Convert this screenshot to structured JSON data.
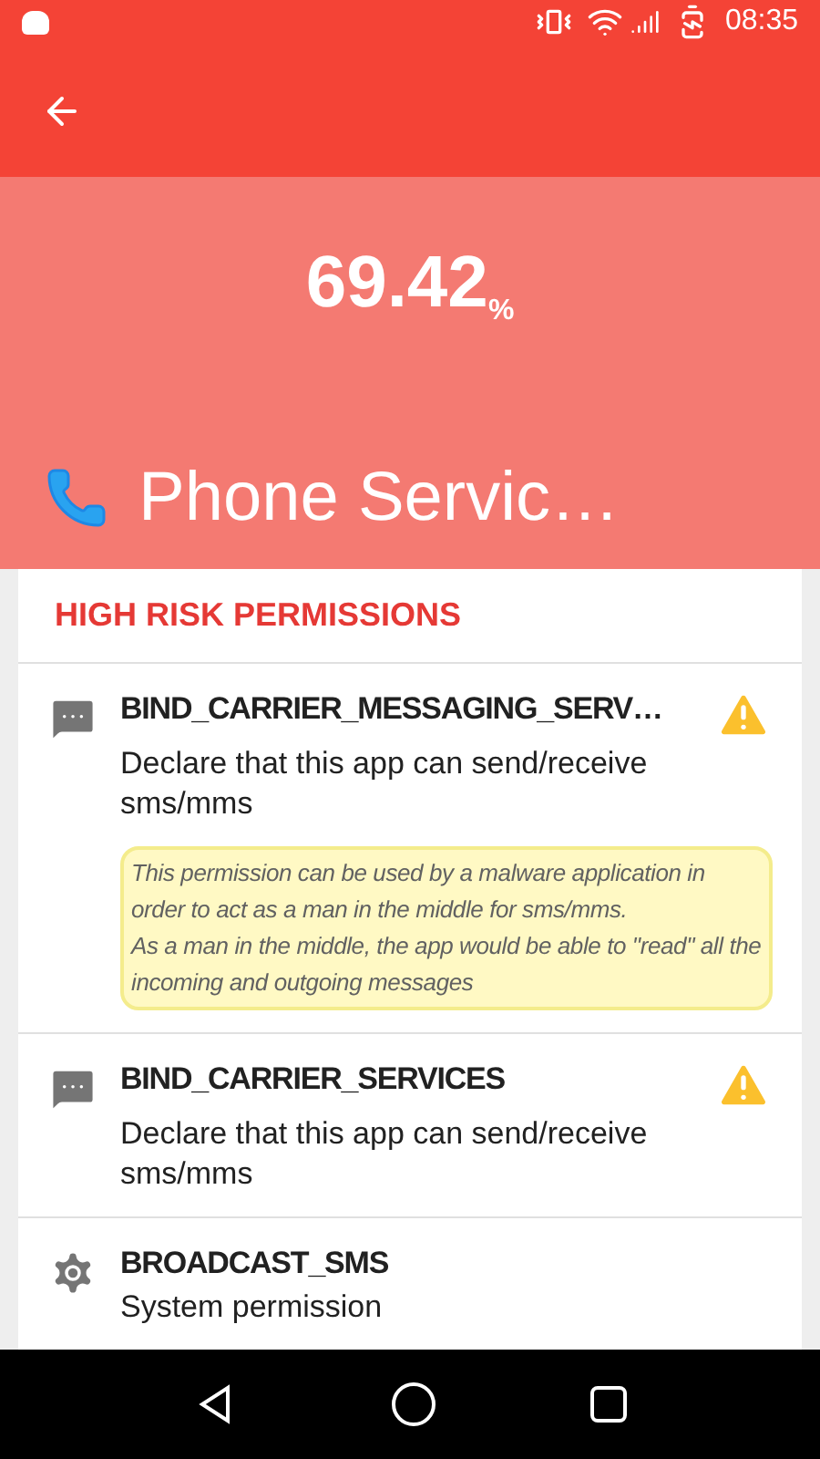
{
  "status_bar": {
    "time": "08:35"
  },
  "header": {
    "score": "69.42",
    "unit": "%",
    "app_name": "Phone Servic…"
  },
  "section": {
    "title": "HIGH RISK PERMISSIONS"
  },
  "permissions": [
    {
      "kind": "message",
      "name": "BIND_CARRIER_MESSAGING_SERV…",
      "description": "Declare that this app can send/receive sms/mms",
      "warning": true,
      "note": "This permission can be used by a malware application in order to act as a man in the middle for sms/mms.\nAs a man in the middle, the app would be able to \"read\" all the incoming and outgoing messages"
    },
    {
      "kind": "message",
      "name": "BIND_CARRIER_SERVICES",
      "description": "Declare that this app can send/receive sms/mms",
      "warning": true
    },
    {
      "kind": "system",
      "name": "BROADCAST_SMS",
      "description": "System permission",
      "warning": false
    }
  ]
}
